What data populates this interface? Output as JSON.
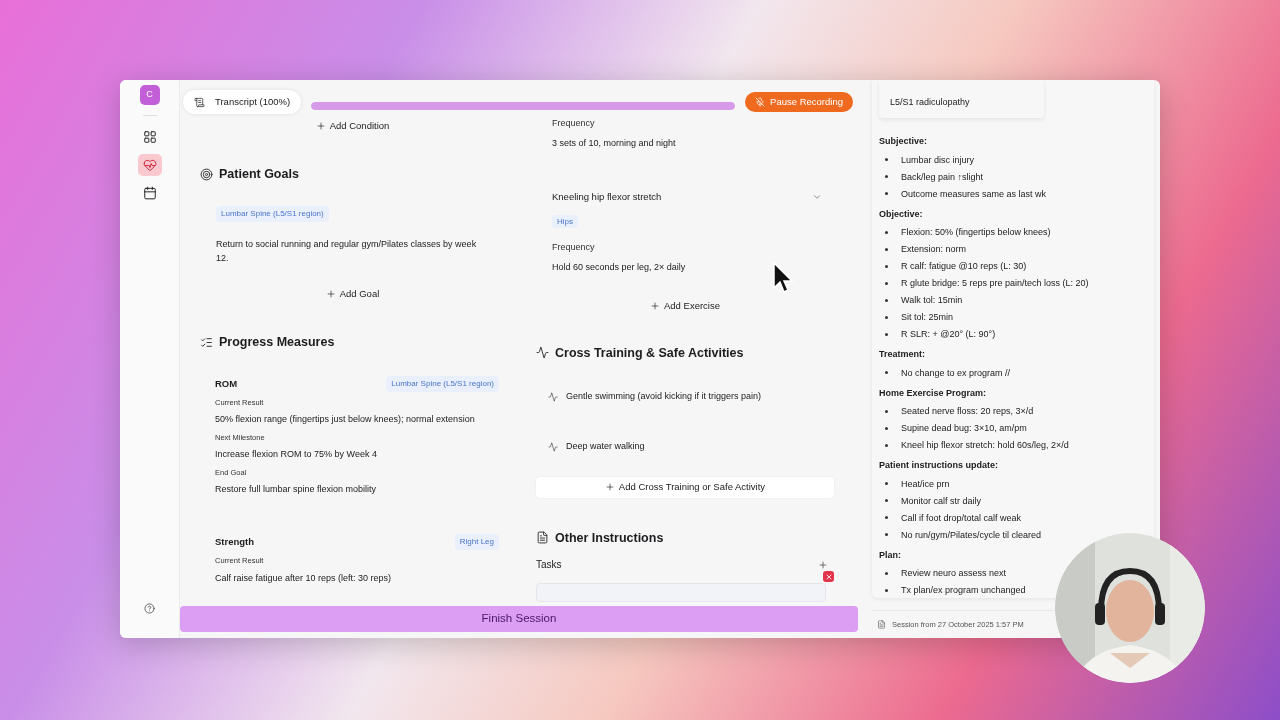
{
  "sidebar": {
    "avatar": "C",
    "items": [
      {
        "kind": "grid",
        "selected": false
      },
      {
        "kind": "heart",
        "selected": true
      },
      {
        "kind": "calendar",
        "selected": false
      }
    ]
  },
  "transcript": {
    "label": "Transcript (100%)"
  },
  "record_button": "Pause Recording",
  "conditions": {
    "add_button": "Add Condition"
  },
  "patient_goals": {
    "title": "Patient Goals",
    "goals": [
      {
        "region": "Lumbar Spine (L5/S1 region)",
        "text": "Return to social running and regular gym/Pilates classes by week 12."
      }
    ],
    "add_button": "Add Goal"
  },
  "progress_measures": {
    "title": "Progress Measures",
    "measures": [
      {
        "name": "ROM",
        "region": "Lumbar Spine (L5/S1 region)",
        "fields": [
          {
            "label": "Current Result",
            "value": "50% flexion range (fingertips just below knees); normal extension"
          },
          {
            "label": "Next Milestone",
            "value": "Increase flexion ROM to 75% by Week 4"
          },
          {
            "label": "End Goal",
            "value": "Restore full lumbar spine flexion mobility"
          }
        ]
      },
      {
        "name": "Strength",
        "region": "Right Leg",
        "fields": [
          {
            "label": "Current Result",
            "value": "Calf raise fatigue after 10 reps (left: 30 reps)"
          }
        ]
      }
    ]
  },
  "exercises": {
    "items": [
      {
        "fields": [
          {
            "label": "Frequency",
            "value": "3 sets of 10, morning and night"
          }
        ]
      },
      {
        "name": "Kneeling hip flexor stretch",
        "tag": "Hips",
        "fields": [
          {
            "label": "Frequency",
            "value": "Hold 60 seconds per leg, 2× daily"
          }
        ]
      }
    ],
    "add_button": "Add Exercise"
  },
  "cross_training": {
    "title": "Cross Training & Safe Activities",
    "activities": [
      "Gentle swimming (avoid kicking if it triggers pain)",
      "Deep water walking"
    ],
    "add_button": "Add Cross Training or Safe Activity"
  },
  "other_instructions": {
    "title": "Other Instructions",
    "tasks_label": "Tasks"
  },
  "finish_button": "Finish Session",
  "notes": {
    "diagnosis": "L5/S1 radiculopathy",
    "sections": [
      {
        "heading": "Subjective:",
        "items": [
          "Lumbar disc injury",
          "Back/leg pain ↑slight",
          "Outcome measures same as last wk"
        ]
      },
      {
        "heading": "Objective:",
        "items": [
          "Flexion: 50% (fingertips below knees)",
          "Extension: norm",
          "R calf: fatigue @10 reps (L: 30)",
          "R glute bridge: 5 reps pre pain/tech loss (L: 20)",
          "Walk tol: 15min",
          "Sit tol: 25min",
          "R SLR: + @20° (L: 90°)"
        ]
      },
      {
        "heading": "Treatment:",
        "items": [
          "No change to ex program //"
        ]
      },
      {
        "heading": "Home Exercise Program:",
        "items": [
          "Seated nerve floss: 20 reps, 3×/d",
          "Supine dead bug: 3×10, am/pm",
          "Kneel hip flexor stretch: hold 60s/leg, 2×/d"
        ]
      },
      {
        "heading": "Patient instructions update:",
        "items": [
          "Heat/ice prn",
          "Monitor calf str daily",
          "Call if foot drop/total calf weak",
          "No run/gym/Pilates/cycle til cleared"
        ]
      },
      {
        "heading": "Plan:",
        "items": [
          "Review neuro assess next",
          "Tx plan/ex program unchanged"
        ]
      }
    ],
    "session": "Session from 27 October 2025 1:57 PM"
  }
}
